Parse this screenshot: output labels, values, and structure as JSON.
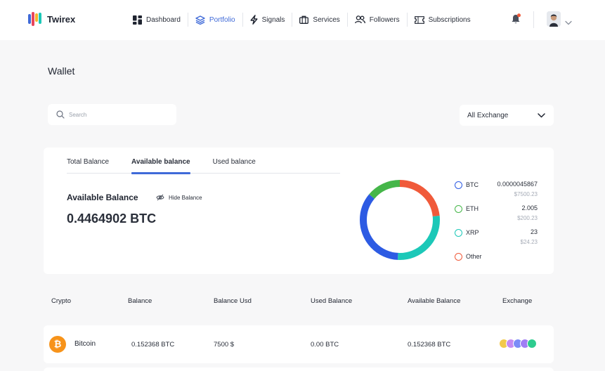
{
  "app": {
    "name": "Twirex"
  },
  "nav": {
    "items": [
      {
        "label": "Dashboard",
        "icon": "dashboard-icon",
        "active": false
      },
      {
        "label": "Portfolio",
        "icon": "layers-icon",
        "active": true
      },
      {
        "label": "Signals",
        "icon": "bolt-icon",
        "active": false
      },
      {
        "label": "Services",
        "icon": "briefcase-icon",
        "active": false
      },
      {
        "label": "Followers",
        "icon": "users-icon",
        "active": false
      },
      {
        "label": "Subscriptions",
        "icon": "ticket-icon",
        "active": false
      }
    ]
  },
  "page": {
    "title": "Wallet"
  },
  "search": {
    "placeholder": "Search"
  },
  "exchange_filter": {
    "selected": "All Exchange"
  },
  "balance_card": {
    "tabs": [
      {
        "label": "Total Balance",
        "active": false
      },
      {
        "label": "Available balance",
        "active": true
      },
      {
        "label": "Used balance",
        "active": false
      }
    ],
    "heading": "Available Balance",
    "hide_label": "Hide Balance",
    "value": "0.4464902 BTC",
    "legend": [
      {
        "name": "BTC",
        "amount": "0.0000045867",
        "usd": "$7500.23",
        "color": "#2d5be3"
      },
      {
        "name": "ETH",
        "amount": "2.005",
        "usd": "$200.23",
        "color": "#45b649"
      },
      {
        "name": "XRP",
        "amount": "23",
        "usd": "$24.23",
        "color": "#1cc8b8"
      },
      {
        "name": "Other",
        "amount": "",
        "usd": "",
        "color": "#f05a3a"
      }
    ]
  },
  "table": {
    "headers": [
      "Crypto",
      "Balance",
      "Balance Usd",
      "Used Balance",
      "Available Balance",
      "Exchange"
    ],
    "rows": [
      {
        "crypto": "Bitcoin",
        "balance": "0.152368 BTC",
        "balance_usd": "7500 $",
        "used": "0.00 BTC",
        "available": "0.152368 BTC"
      }
    ]
  },
  "colors": {
    "accent": "#3f6ad8",
    "bitcoin": "#f7931a",
    "notification": "#f05a3a",
    "logo": [
      "#3f6ad8",
      "#e8455c",
      "#f7b32b",
      "#1cc8b8"
    ],
    "exchange_icons": [
      "#f2c94c",
      "#c58bf2",
      "#7b8cf7",
      "#a07ef5",
      "#2ecc8f"
    ]
  }
}
